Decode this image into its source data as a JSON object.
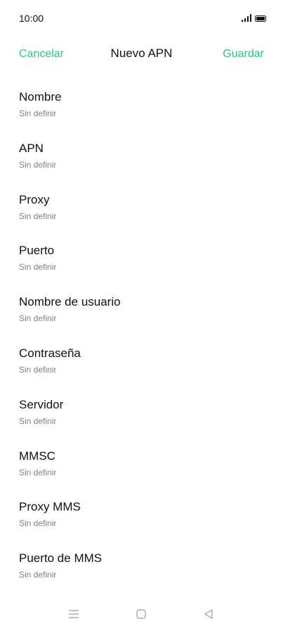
{
  "status_bar": {
    "time": "10:00",
    "icons": [
      "signal-icon",
      "battery-icon"
    ]
  },
  "header": {
    "cancel_label": "Cancelar",
    "title": "Nuevo APN",
    "save_label": "Guardar",
    "accent_color": "#2ec47a"
  },
  "settings": [
    {
      "label": "Nombre",
      "value": "Sin definir"
    },
    {
      "label": "APN",
      "value": "Sin definir"
    },
    {
      "label": "Proxy",
      "value": "Sin definir"
    },
    {
      "label": "Puerto",
      "value": "Sin definir"
    },
    {
      "label": "Nombre de usuario",
      "value": "Sin definir"
    },
    {
      "label": "Contraseña",
      "value": "Sin definir"
    },
    {
      "label": "Servidor",
      "value": "Sin definir"
    },
    {
      "label": "MMSC",
      "value": "Sin definir"
    },
    {
      "label": "Proxy MMS",
      "value": "Sin definir"
    },
    {
      "label": "Puerto de MMS",
      "value": "Sin definir"
    }
  ],
  "nav_bar": {
    "icons": [
      "menu-icon",
      "home-icon",
      "back-icon"
    ]
  }
}
